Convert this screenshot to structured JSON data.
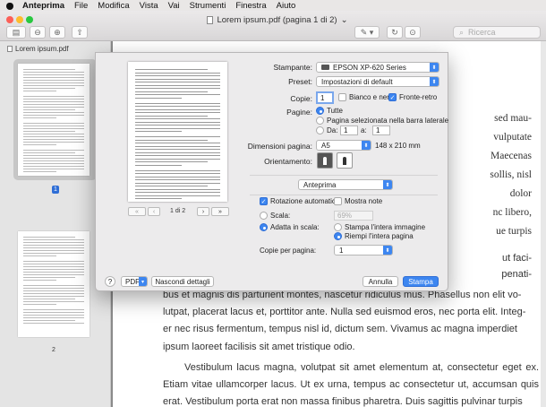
{
  "menubar": {
    "app": "Anteprima",
    "items": [
      "File",
      "Modifica",
      "Vista",
      "Vai",
      "Strumenti",
      "Finestra",
      "Aiuto"
    ]
  },
  "window": {
    "title": "Lorem ipsum.pdf (pagina 1 di 2)",
    "title_chevron": "⌄",
    "search_placeholder": "Ricerca"
  },
  "sidebar": {
    "file_name": "Lorem ipsum.pdf",
    "pages": [
      {
        "label": "1",
        "selected": true
      },
      {
        "label": "2",
        "selected": false
      }
    ]
  },
  "document": {
    "right_fragments": [
      "sed mau-",
      "vulputate",
      "Maecenas",
      "sollis, nisl",
      "dolor",
      "nc libero,",
      "ue turpis",
      "ut faci-",
      "penati-"
    ],
    "lines": [
      "bus et magnis dis parturient montes, nascetur ridiculus mus. Phasellus non elit vo-",
      "lutpat, placerat lacus et, porttitor ante. Nulla sed euismod eros, nec porta elit. Integ-",
      "er nec risus fermentum, tempus nisl id, dictum sem. Vivamus ac magna imperdiet",
      "ipsum laoreet facilisis sit amet tristique odio."
    ],
    "para2": "Vestibulum lacus magna, volutpat sit amet elementum at, consectetur eget ex. Etiam vitae ullamcorper lacus. Ut ex urna, tempus ac consectetur ut, accumsan quis erat. Vestibulum porta erat non massa finibus pharetra. Duis sagittis pulvinar turpis"
  },
  "print_dialog": {
    "preview_nav": {
      "first": "«",
      "prev": "‹",
      "page_label": "1 di 2",
      "next": "›",
      "last": "»"
    },
    "printer_label": "Stampante:",
    "printer_value": "EPSON XP-620 Series",
    "preset_label": "Preset:",
    "preset_value": "Impostazioni di default",
    "copies_label": "Copie:",
    "copies_value": "1",
    "bw_label": "Bianco e nero",
    "bw_checked": false,
    "duplex_label": "Fronte-retro",
    "duplex_checked": true,
    "pages_label": "Pagine:",
    "pages_all": "Tutte",
    "pages_selected": "Pagina selezionata nella barra laterale",
    "pages_from_label": "Da:",
    "pages_from": "1",
    "pages_to_label": "a:",
    "pages_to": "1",
    "paper_label": "Dimensioni pagina:",
    "paper_value": "A5",
    "paper_dims": "148 x 210 mm",
    "orientation_label": "Orientamento:",
    "section_value": "Anteprima",
    "auto_rotate_label": "Rotazione automatica",
    "auto_rotate_checked": true,
    "show_notes_label": "Mostra note",
    "show_notes_checked": false,
    "scale_label": "Scala:",
    "scale_value": "69%",
    "fit_label": "Adatta in scala:",
    "fit_whole": "Stampa l'intera immagine",
    "fit_fill": "Riempi l'intera pagina",
    "per_page_label": "Copie per pagina:",
    "per_page_value": "1",
    "help": "?",
    "pdf_button": "PDF",
    "hide_details": "Nascondi dettagli",
    "cancel": "Annulla",
    "print": "Stampa"
  },
  "colors": {
    "accent": "#3d86f0",
    "sidebar": "#e4e4e4",
    "dialog": "#ecebec"
  }
}
